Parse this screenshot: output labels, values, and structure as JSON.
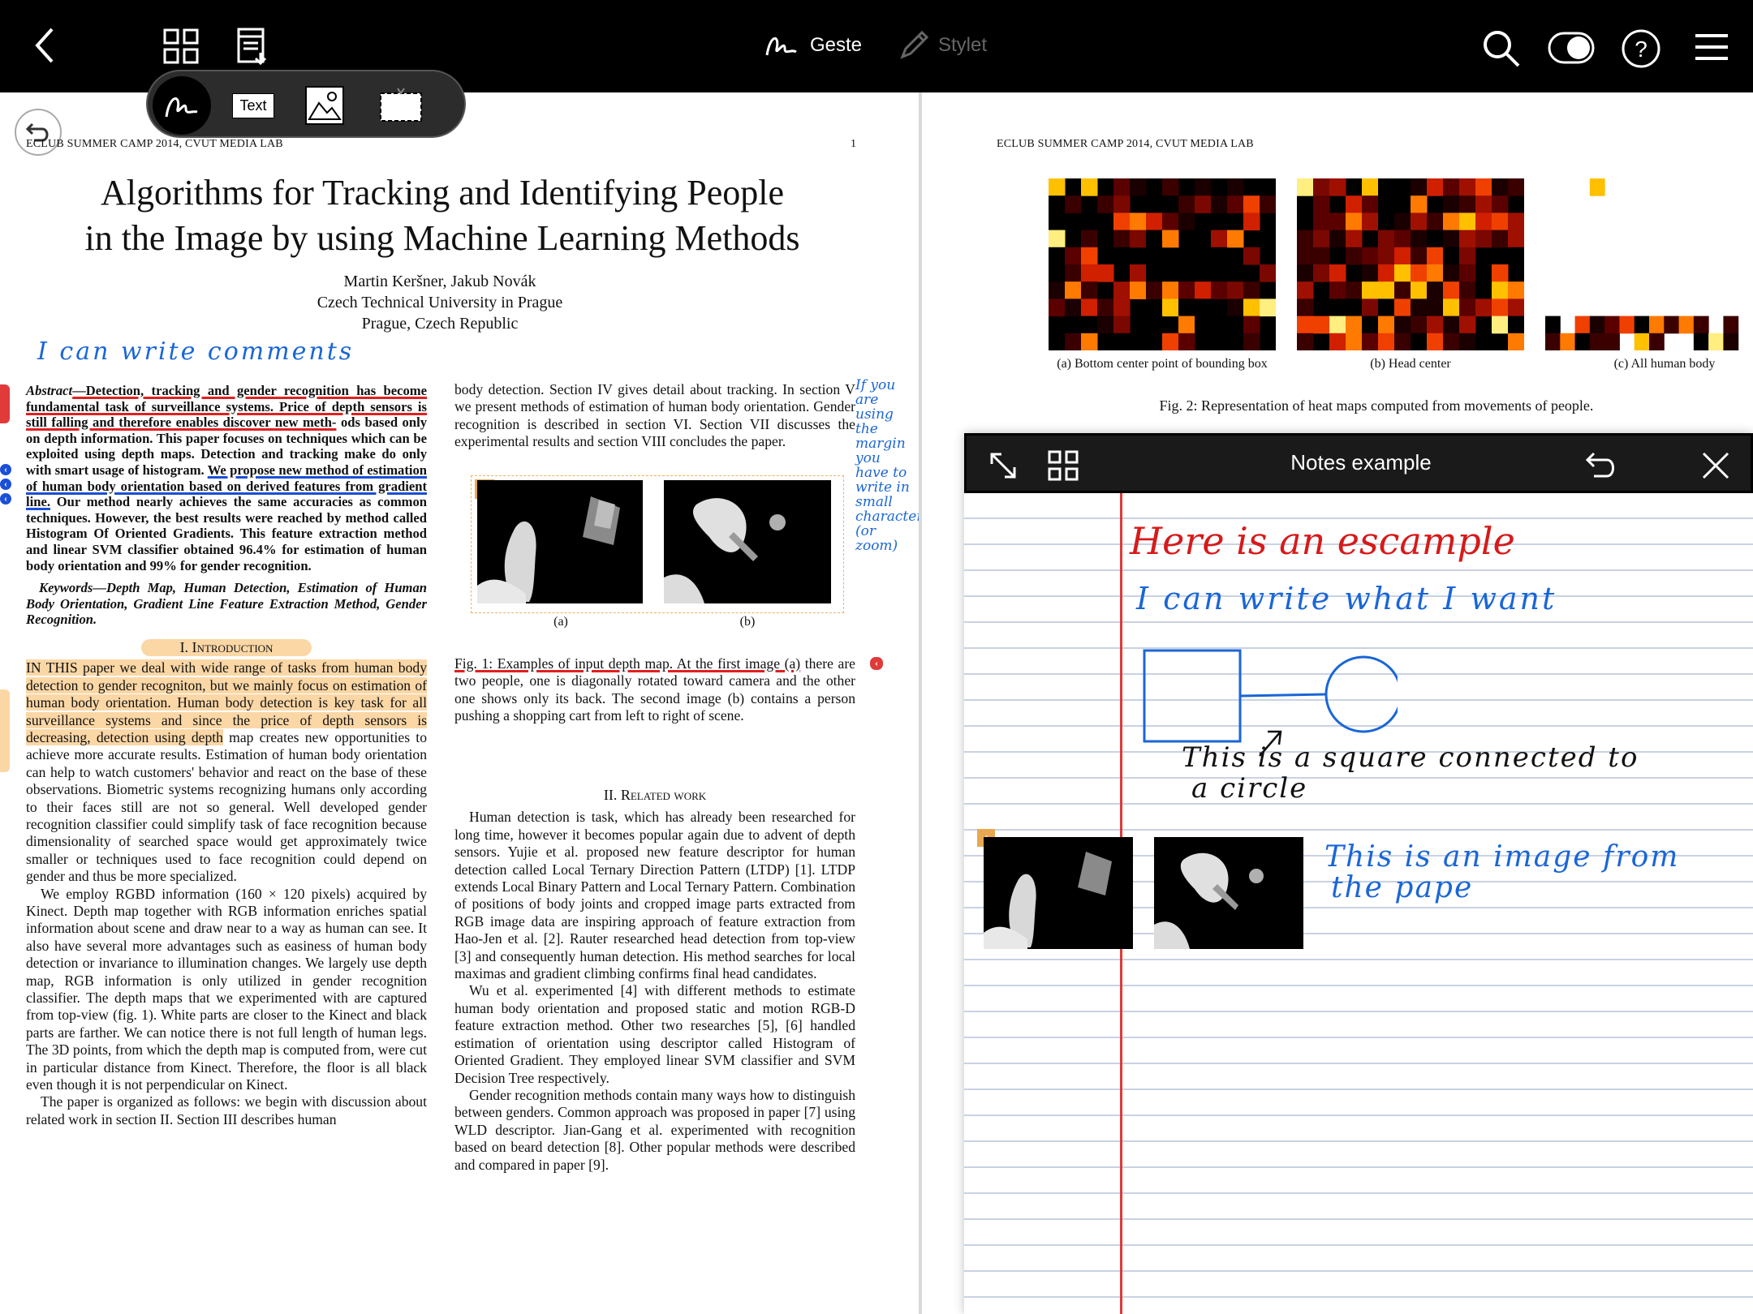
{
  "toolbar": {
    "gesture_label": "Geste",
    "stylus_label": "Stylet",
    "icons": [
      "back-icon",
      "thumbnails-icon",
      "export-icon",
      "gesture-icon",
      "stylus-icon",
      "search-icon",
      "toggle-icon",
      "help-icon",
      "menu-icon"
    ]
  },
  "palette": {
    "text_tool_label": "Text",
    "tools": [
      "pen-tool",
      "text-tool",
      "image-tool",
      "selection-tool"
    ]
  },
  "paper_left": {
    "running_header": "ECLUB SUMMER CAMP 2014, CVUT MEDIA LAB",
    "page_number": "1",
    "title_line1": "Algorithms for Tracking and Identifying People",
    "title_line2": "in the Image by using Machine Learning Methods",
    "authors": "Martin Keršner, Jakub Novák",
    "affiliation": "Czech Technical University in Prague",
    "address": "Prague, Czech Republic",
    "handwritten_comment": "I can write comments",
    "abstract_label": "Abstract",
    "abstract_u1": "—Detection, tracking and gender recognition has become fundamental task of surveillance systems. Price of depth sensors is still falling and therefore enables discover new meth-",
    "abstract_plain1": "ods based only on depth information. This paper focuses on techniques which can be exploited using depth maps. Detection and tracking make do only with smart usage of histogram.",
    "abstract_u2": "We propose new method of estimation of human body orientation based on derived features from gradient line.",
    "abstract_plain2": "Our method nearly achieves the same accuracies as common techniques. However, the best results were reached by method called Histogram Of Oriented Gradients. This feature extraction method and linear SVM classifier obtained 96.4% for estimation of human body orientation and 99% for gender recognition.",
    "keywords_label": "Keywords",
    "keywords": "—Depth Map, Human Detection, Estimation of Human Body Orientation, Gradient Line Feature Extraction Method, Gender Recognition.",
    "section1_title": "I. Introduction",
    "intro_highlight": "IN THIS paper we deal with wide range of tasks from human body detection to gender recogniton, but we mainly focus on estimation of human body orientation. Human body detection is key task for all surveillance systems and since the price of depth sensors is decreasing, detection using depth",
    "intro_rest": "map creates new opportunities to achieve more accurate results. Estimation of human body orientation can help to watch customers' behavior and react on the base of these observations. Biometric systems recognizing humans only according to their faces still are not so general. Well developed gender recognition classifier could simplify task of face recognition because dimensionality of searched space would get approximately twice smaller or techniques used to face recognition could depend on gender and thus be more specialized.",
    "intro_p2": "We employ RGBD information (160 × 120 pixels) acquired by Kinect. Depth map together with RGB information enriches spatial information about scene and draw near to a way as human can see. It also have several more advantages such as easiness of human body detection or invariance to illumination changes. We largely use depth map, RGB information is only utilized in gender recognition classifier. The depth maps that we experimented with are captured from top-view (fig. 1). White parts are closer to the Kinect and black parts are farther. We can notice there is not full length of human legs. The 3D points, from which the depth map is computed from, were cut in particular distance from Kinect. Therefore, the floor is all black even though it is not perpendicular on Kinect.",
    "intro_p3": "The paper is organized as follows: we begin with discussion about related work in section II. Section III describes human",
    "col2_p1": "body detection. Section IV gives detail about tracking. In section V we present methods of estimation of human body orientation. Gender recognition is described in section VI. Section VII discusses the experimental results and section VIII concludes the paper.",
    "margin_note": "If you are using the margin you have to write in small characters (or zoom)",
    "fig1_sub_a": "(a)",
    "fig1_sub_b": "(b)",
    "fig1_caption_u": "Fig. 1: Examples of input depth map. At the first image (a)",
    "fig1_caption_rest": "there are two people, one is diagonally rotated toward camera and the other one shows only its back. The second image (b) contains a person pushing a shopping cart from left to right of scene.",
    "section2_title": "II. Related work",
    "rw_p1": "Human detection is task, which has already been researched for long time, however it becomes popular again due to advent of depth sensors. Yujie et al. proposed new feature descriptor for human detection called Local Ternary Direction Pattern (LTDP) [1]. LTDP extends Local Binary Pattern and Local Ternary Pattern. Combination of positions of body joints and cropped image parts extracted from RGB image data are inspiring approach of feature extraction from Hao-Jen et al. [2]. Rauter researched head detection from top-view [3] and consequently human detection. His method searches for local maximas and gradient climbing confirms final head candidates.",
    "rw_p2": "Wu et al. experimented [4] with different methods to estimate human body orientation and proposed static and motion RGB-D feature extraction method. Other two researches [5], [6] handled estimation of orientation using descriptor called Histogram of Oriented Gradient. They employed linear SVM classifier and SVM Decision Tree respectively.",
    "rw_p3": "Gender recognition methods contain many ways how to distinguish between genders. Common approach was proposed in paper [7] using WLD descriptor. Jian-Gang et al. experimented with recognition based on beard detection [8]. Other popular methods were described and compared in paper [9]."
  },
  "paper_right": {
    "running_header": "ECLUB SUMMER CAMP 2014, CVUT MEDIA LAB",
    "cap_a": "(a) Bottom center point of bounding box",
    "cap_b": "(b) Head center",
    "cap_c": "(c) All human body",
    "fig2_caption": "Fig. 2: Representation of heat maps computed from movements of people."
  },
  "notes": {
    "title": "Notes example",
    "line1": "Here is an escample",
    "line2": "I can write what I want",
    "line3a": "This is a square connected to",
    "line3b": "a circle",
    "line4a": "This is an image from",
    "line4b": "the pape"
  },
  "colors": {
    "accent_blue": "#1a66d6",
    "annotation_red": "#e02020",
    "highlight_orange": "#fbd7a6",
    "toolbar_bg": "#000000"
  }
}
